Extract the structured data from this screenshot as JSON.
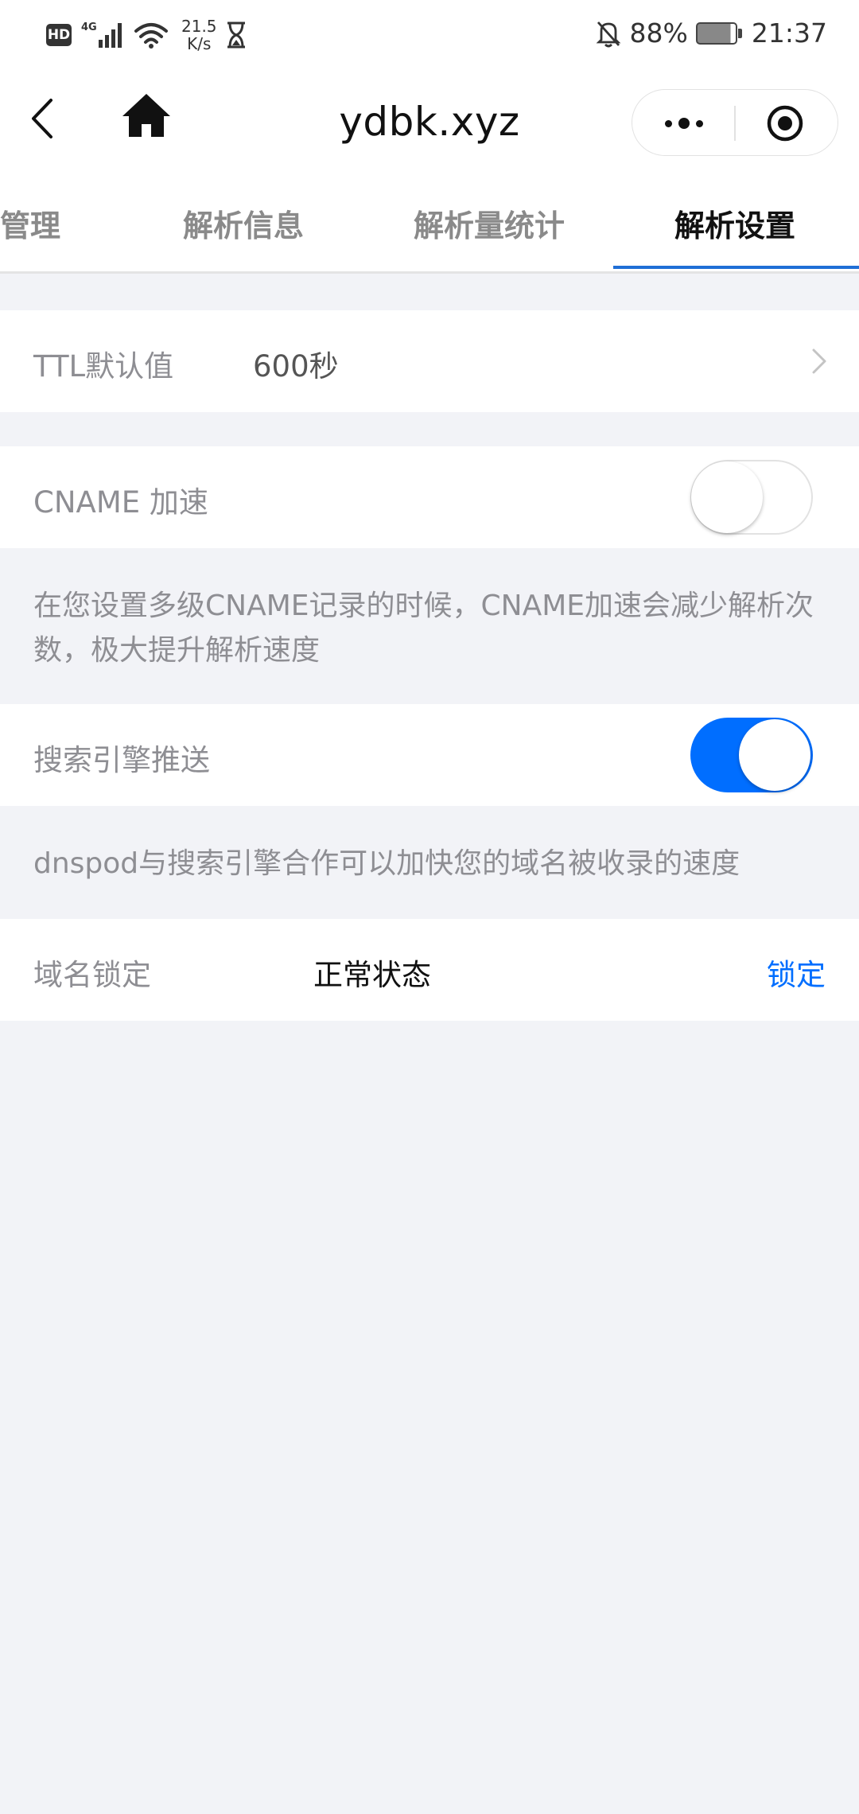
{
  "status_bar": {
    "hd": "HD",
    "network": "4G",
    "speed_value": "21.5",
    "speed_unit": "K/s",
    "battery": "88%",
    "time": "21:37"
  },
  "nav": {
    "title": "ydbk.xyz"
  },
  "tabs": [
    {
      "label": "管理",
      "active": false
    },
    {
      "label": "解析信息",
      "active": false
    },
    {
      "label": "解析量统计",
      "active": false
    },
    {
      "label": "解析设置",
      "active": true
    }
  ],
  "settings": {
    "ttl": {
      "label": "TTL默认值",
      "value": "600秒"
    },
    "cname": {
      "label": "CNAME 加速",
      "enabled": false,
      "description": "在您设置多级CNAME记录的时候，CNAME加速会减少解析次数，极大提升解析速度"
    },
    "seo": {
      "label": "搜索引擎推送",
      "enabled": true,
      "description": "dnspod与搜索引擎合作可以加快您的域名被收录的速度"
    },
    "domain_lock": {
      "label": "域名锁定",
      "status": "正常状态",
      "action": "锁定"
    }
  },
  "colors": {
    "accent": "#006eff",
    "page_bg": "#f2f3f7",
    "label_gray": "#8e8e93"
  },
  "icons": {
    "back": "chevron-left-icon",
    "home": "home-icon",
    "more": "more-dots-icon",
    "close": "target-circle-icon"
  }
}
